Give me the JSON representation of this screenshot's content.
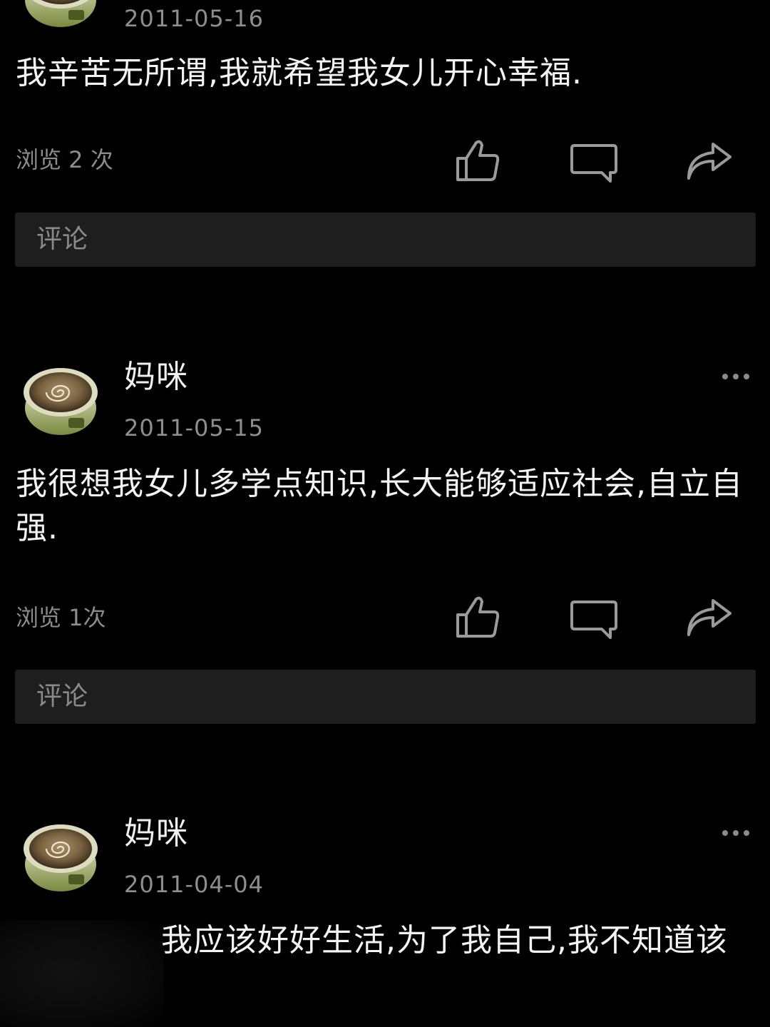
{
  "posts": [
    {
      "date": "2011-05-16",
      "content": "我辛苦无所谓,我就希望我女儿开心幸福.",
      "views": "浏览 2 次",
      "comment_placeholder": "评论"
    },
    {
      "author": "妈咪",
      "date": "2011-05-15",
      "content": "我很想我女儿多学点知识,长大能够适应社会,自立自强.",
      "views": "浏览 1次",
      "comment_placeholder": "评论"
    },
    {
      "author": "妈咪",
      "date": "2011-04-04",
      "content": "我应该好好生活,为了我自己,我不知道该"
    }
  ],
  "icons": {
    "like": "thumbs-up-icon",
    "comment": "comment-bubble-icon",
    "share": "share-arrow-icon",
    "more": "more-dots-icon"
  },
  "colors": {
    "background": "#000000",
    "text": "#f2f2f2",
    "muted": "#8e8e8e",
    "comment_box": "#1e1e1e",
    "icon": "#9a9a9a"
  }
}
